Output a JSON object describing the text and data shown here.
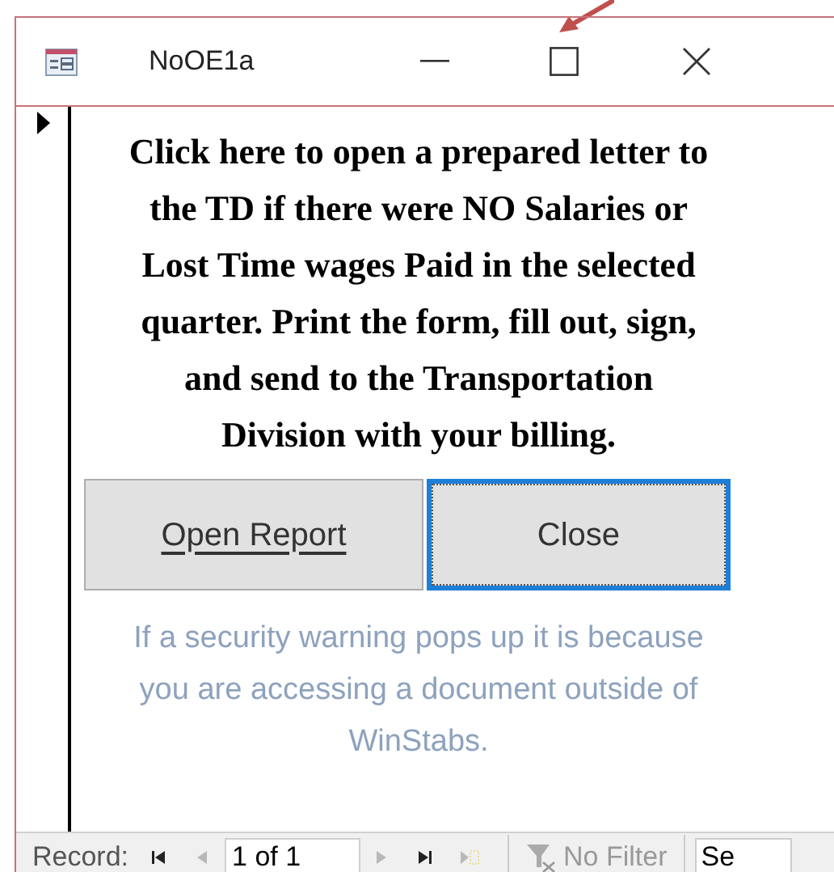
{
  "window": {
    "title": "NoOE1a"
  },
  "record_selector": {
    "current": true
  },
  "instructions": "Click here to open a prepared letter to the TD if there were NO Salaries or Lost Time wages Paid in the selected quarter.  Print the form, fill out, sign, and send to the Transportation Division with your billing.",
  "buttons": [
    {
      "label": "Open Report",
      "underlined": true,
      "focused": false
    },
    {
      "label": "Close",
      "underlined": false,
      "focused": true
    }
  ],
  "note": "If a security warning pops up it is because you are accessing a document outside of WinStabs.",
  "navigation": {
    "label": "Record:",
    "nav_buttons": [
      {
        "kind": "first",
        "disabled": false
      },
      {
        "kind": "prev",
        "disabled": true
      },
      {
        "kind": "next",
        "disabled": true
      },
      {
        "kind": "last",
        "disabled": false
      },
      {
        "kind": "new",
        "disabled": true
      }
    ],
    "position": "1 of 1",
    "filter": "No Filter",
    "search": "Se"
  }
}
